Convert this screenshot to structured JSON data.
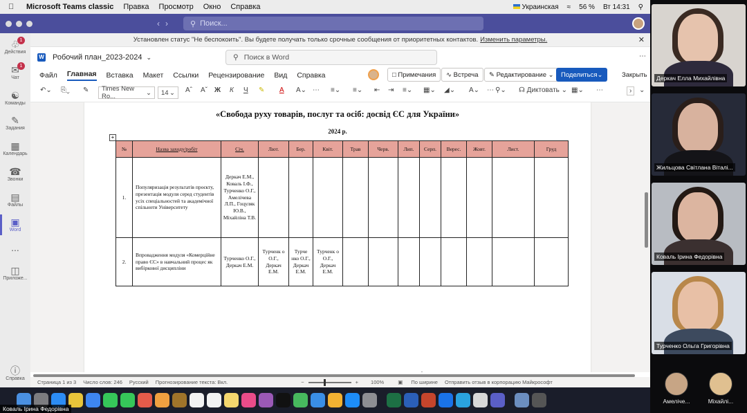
{
  "menubar": {
    "app": "Microsoft Teams classic",
    "items": [
      "Правка",
      "Просмотр",
      "Окно",
      "Справка"
    ],
    "keyboard": "Украинская",
    "battery": "56 %",
    "clock": "Вт 14:31"
  },
  "teams": {
    "search_placeholder": "Поиск...",
    "dnd_banner": "Установлен статус \"Не беспокоить\". Вы будете получать только срочные сообщения от приоритетных контактов.",
    "dnd_link": "Изменить параметры.",
    "sidebar": [
      {
        "label": "Действия",
        "icon": "bell-icon",
        "badge": "1"
      },
      {
        "label": "Чат",
        "icon": "chat-icon",
        "badge": "1"
      },
      {
        "label": "Команды",
        "icon": "teams-icon"
      },
      {
        "label": "Задания",
        "icon": "assignments-icon"
      },
      {
        "label": "Календарь",
        "icon": "calendar-icon"
      },
      {
        "label": "Звонки",
        "icon": "phone-icon"
      },
      {
        "label": "Файлы",
        "icon": "files-icon"
      },
      {
        "label": "Word",
        "icon": "word-icon"
      },
      {
        "label": "...",
        "icon": "more-icon"
      },
      {
        "label": "Приложе...",
        "icon": "apps-icon"
      },
      {
        "label": "Справка",
        "icon": "help-icon"
      }
    ]
  },
  "word": {
    "doc_name": "Робочий план_2023-2024",
    "search": "Поиск в Word",
    "tabs": [
      "Файл",
      "Главная",
      "Вставка",
      "Макет",
      "Ссылки",
      "Рецензирование",
      "Вид",
      "Справка"
    ],
    "comments": "Примечания",
    "meeting": "Встреча",
    "editing": "Редактирование",
    "share": "Поделиться",
    "close": "Закрыть",
    "font": "Times New Ro...",
    "font_size": "14",
    "dictate": "Диктовать",
    "status": {
      "page": "Страница 1 из 3",
      "words": "Число слов: 246",
      "lang": "Русский",
      "predict": "Прогнозирование текста: Вкл.",
      "zoom": "100%",
      "fit": "По ширине",
      "feedback": "Отправить отзыв в корпорацию Майкрософт"
    }
  },
  "document": {
    "title": "«Свобода руху товарів, послуг та осіб: досвід ЄС для України»",
    "year": "2024 р.",
    "headers": [
      "№",
      "Назва заходу/робіт",
      "Січ.",
      "Лют.",
      "Бер.",
      "Квіт.",
      "Трав",
      "Черв.",
      "Лип.",
      "Серп.",
      "Верес.",
      "Жовт.",
      "Лист.",
      "Груд"
    ],
    "rows": [
      {
        "num": "1.",
        "activity": "Популяризація результатів проєкту, презентація модуля серед студентів усіх спеціальностей та академічної спільноти Університету",
        "cells": [
          "Деркач Е.М., Коваль І.Ф., Турченко О.Г., Амелічева Л.П., Гоцуляк Ю.В., Міхайліна Т.В.",
          "",
          "",
          "",
          "",
          "",
          "",
          "",
          "",
          "",
          "",
          ""
        ]
      },
      {
        "num": "2.",
        "activity": "Впровадження модуля «Комерційне право ЄС» в навчальний процес як вибіркової дисципліни",
        "cells": [
          "Турченко О.Г., Деркач Е.М.",
          "Турченк о О.Г., Деркач Е.М.",
          "Турче нко О.Г., Деркач Е.М.",
          "Турченк о О.Г., Деркач Е.М.",
          "",
          "",
          "",
          "",
          "",
          "",
          "",
          ""
        ]
      }
    ]
  },
  "participants": [
    {
      "name": "Деркач Елла Михайлівна"
    },
    {
      "name": "Жильцова Світлана Віталі..."
    },
    {
      "name": "Коваль Ірина Федорівна"
    },
    {
      "name": "Турченко Ольга Григорівна"
    }
  ],
  "mini_participants": [
    {
      "name": "Амеліче..."
    },
    {
      "name": "Міхайлі..."
    }
  ],
  "dock_label": "Коваль Ірина Федорівна"
}
